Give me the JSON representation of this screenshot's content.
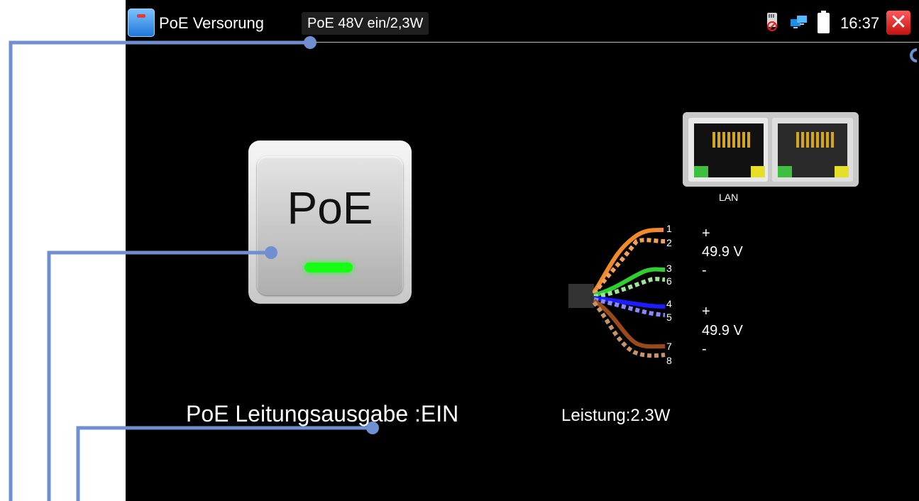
{
  "app": {
    "title": "PoE Versorung",
    "status_pill": "PoE 48V ein/2,3W",
    "clock": "16:37",
    "close_icon": "close-icon"
  },
  "status_icons": [
    "sd-card-icon",
    "network-icon",
    "battery-icon"
  ],
  "poe_button": {
    "label": "PoE",
    "led_color": "#1aff1a"
  },
  "lan": {
    "label": "LAN"
  },
  "pins": [
    "1",
    "2",
    "3",
    "6",
    "4",
    "5",
    "7",
    "8"
  ],
  "pairs": [
    {
      "sign_top": "+",
      "voltage": "49.9 V",
      "sign_bottom": "-"
    },
    {
      "sign_top": "+",
      "voltage": "49.9 V",
      "sign_bottom": "-"
    }
  ],
  "output_status": "PoE Leitungsausgabe :EIN",
  "power_reading": "Leistung:2.3W",
  "colors": {
    "screen_bg": "#000000",
    "callout_line": "#6f8fd0",
    "wire_orange": "#f08a2a",
    "wire_green": "#2ecf2e",
    "wire_blue": "#1c1cff",
    "wire_brown": "#9a4a1a"
  }
}
